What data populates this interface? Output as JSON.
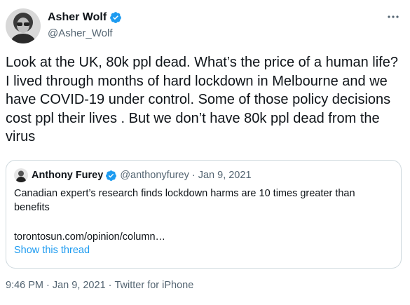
{
  "colors": {
    "text_primary": "#0f1419",
    "text_secondary": "#536471",
    "accent_blue": "#1d9bf0",
    "border": "#cfd9de"
  },
  "author": {
    "display_name": "Asher Wolf",
    "handle": "@Asher_Wolf",
    "verified": true,
    "avatar_icon": "profile-photo"
  },
  "more_menu_icon": "ellipsis-icon",
  "tweet": {
    "text": "Look at the UK, 80k ppl dead. What’s the price of a human life? I lived through months of hard lockdown in Melbourne and we have COVID-19 under control. Some of those policy decisions cost ppl their lives . But we don’t have 80k ppl dead from the virus"
  },
  "quoted_tweet": {
    "display_name": "Anthony Furey",
    "handle": "@anthonyfurey",
    "separator": "·",
    "date": "Jan 9, 2021",
    "verified": true,
    "text": "Canadian expert’s research finds lockdown harms are 10 times greater than benefits",
    "link": "torontosun.com/opinion/column…",
    "show_thread": "Show this thread"
  },
  "meta": {
    "time": "9:46 PM",
    "separator": "·",
    "date": "Jan 9, 2021",
    "source": "Twitter for iPhone"
  }
}
